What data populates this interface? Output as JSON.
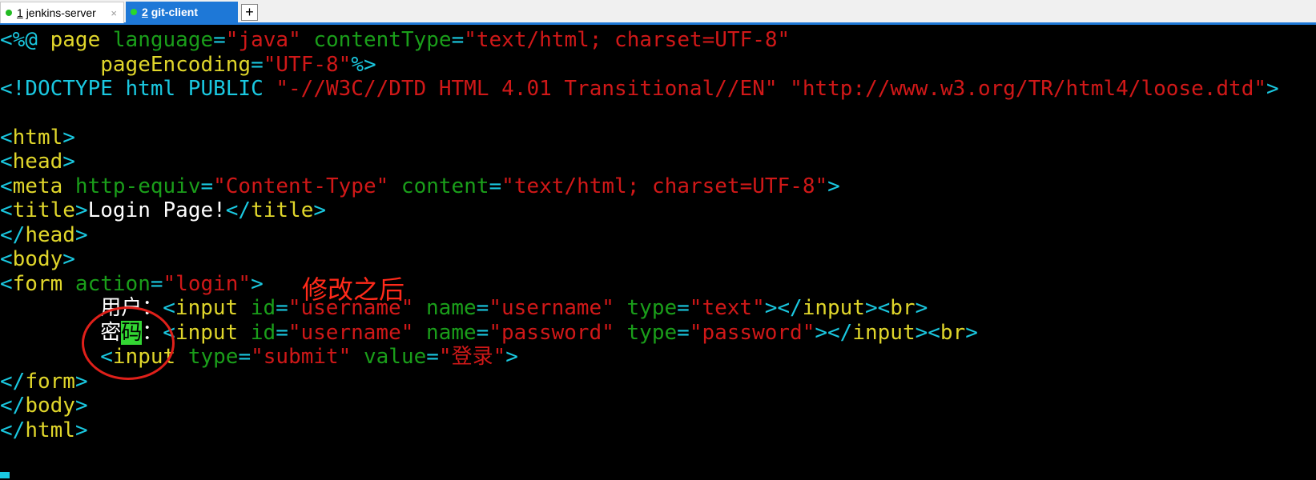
{
  "tabs": [
    {
      "number": "1",
      "label": "jenkins-server",
      "close": "×",
      "active": false
    },
    {
      "number": "2",
      "label": "git-client",
      "active": true
    }
  ],
  "new_tab": "+",
  "annotation": "修改之后",
  "colors": {
    "tag": "#1ac8e0",
    "keyword": "#e0d62b",
    "attr": "#1a9e1a",
    "string": "#d01818",
    "text": "#ffffff",
    "annotation": "#ff2a1a",
    "tab_active": "#1e78d7"
  },
  "code": {
    "l1": {
      "a": "<%@ ",
      "b": "page",
      "c": " language",
      "d": "=",
      "e": "\"java\"",
      "f": " contentType",
      "g": "=",
      "h": "\"text/html; charset=UTF-8\""
    },
    "l2": {
      "a": "        ",
      "b": "pageEncoding",
      "c": "=",
      "d": "\"UTF-8\"",
      "e": "%>"
    },
    "l3": {
      "a": "<!DOCTYPE html PUBLIC ",
      "b": "\"-//W3C//DTD HTML 4.01 Transitional//EN\"",
      "c": " ",
      "d": "\"http://www.w3.org/TR/html4/loose.dtd\"",
      "e": ">"
    },
    "l5": {
      "a": "<",
      "b": "html",
      "c": ">"
    },
    "l6": {
      "a": "<",
      "b": "head",
      "c": ">"
    },
    "l7": {
      "a": "<",
      "b": "meta",
      "c": " http-equiv",
      "d": "=",
      "e": "\"Content-Type\"",
      "f": " content",
      "g": "=",
      "h": "\"text/html; charset=UTF-8\"",
      "i": ">"
    },
    "l8": {
      "a": "<",
      "b": "title",
      "c": ">",
      "d": "Login Page!",
      "e": "</",
      "f": "title",
      "g": ">"
    },
    "l9": {
      "a": "</",
      "b": "head",
      "c": ">"
    },
    "l10": {
      "a": "<",
      "b": "body",
      "c": ">"
    },
    "l11": {
      "a": "<",
      "b": "form",
      "c": " action",
      "d": "=",
      "e": "\"login\"",
      "f": ">"
    },
    "l12": {
      "a": "        ",
      "b": "用户",
      "c": "：",
      "d": "<",
      "e": "input",
      "f": " id",
      "g": "=",
      "h": "\"username\"",
      "i": " name",
      "j": "=",
      "k": "\"username\"",
      "l": " type",
      "m": "=",
      "n": "\"text\"",
      "o": "></",
      "p": "input",
      "q": "><",
      "r": "br",
      "s": ">"
    },
    "l13": {
      "a": "        ",
      "b": "密",
      "b2": "码",
      "c": "：",
      "d": "<",
      "e": "input",
      "f": " id",
      "g": "=",
      "h": "\"username\"",
      "i": " name",
      "j": "=",
      "k": "\"password\"",
      "l": " type",
      "m": "=",
      "n": "\"password\"",
      "o": "></",
      "p": "input",
      "q": "><",
      "r": "br",
      "s": ">"
    },
    "l14": {
      "a": "        <",
      "b": "input",
      "c": " type",
      "d": "=",
      "e": "\"submit\"",
      "f": " value",
      "g": "=",
      "h": "\"登录\"",
      "i": ">"
    },
    "l15": {
      "a": "</",
      "b": "form",
      "c": ">"
    },
    "l16": {
      "a": "</",
      "b": "body",
      "c": ">"
    },
    "l17": {
      "a": "</",
      "b": "html",
      "c": ">"
    }
  }
}
